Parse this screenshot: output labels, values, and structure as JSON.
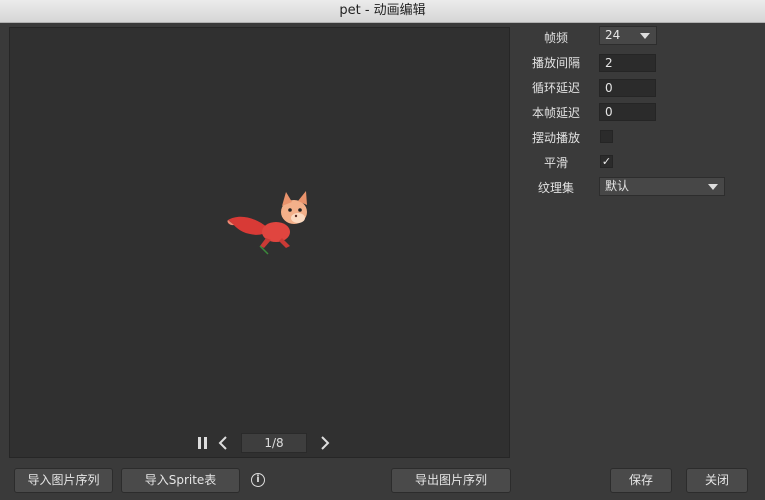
{
  "window": {
    "title": "pet - 动画编辑"
  },
  "player": {
    "frame_indicator": "1/8",
    "pause_icon": "pause-icon",
    "prev_icon": "chevron-left-icon",
    "next_icon": "chevron-right-icon"
  },
  "properties": {
    "fps": {
      "label": "帧频",
      "value": "24"
    },
    "play_interval": {
      "label": "播放间隔",
      "value": "2"
    },
    "loop_delay": {
      "label": "循环延迟",
      "value": "0"
    },
    "frame_delay": {
      "label": "本帧延迟",
      "value": "0"
    },
    "swing": {
      "label": "摆动播放",
      "checked": false
    },
    "smooth": {
      "label": "平滑",
      "checked": true,
      "mark": "✓"
    },
    "atlas": {
      "label": "纹理集",
      "value": "默认"
    }
  },
  "buttons": {
    "import_sequence": "导入图片序列",
    "import_sprite": "导入Sprite表",
    "info_icon": "i",
    "export_sequence": "导出图片序列",
    "save": "保存",
    "close": "关闭"
  },
  "colors": {
    "background": "#3a3a3a",
    "preview_bg": "#303030",
    "sprite_red": "#e0453f",
    "sprite_skin": "#f3b08a"
  }
}
